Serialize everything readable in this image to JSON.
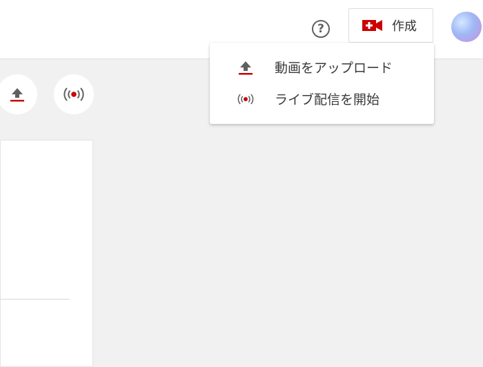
{
  "header": {
    "help_icon": "help-circle-icon",
    "help_glyph": "?",
    "create_button": {
      "label": "作成",
      "icon": "video-camera-plus-icon"
    },
    "avatar_icon": "account-avatar"
  },
  "toolbar": {
    "upload_icon": "upload-icon",
    "live_icon": "live-broadcast-icon"
  },
  "create_menu": {
    "items": [
      {
        "label": "動画をアップロード",
        "icon": "upload-icon"
      },
      {
        "label": "ライブ配信を開始",
        "icon": "live-broadcast-icon"
      }
    ]
  },
  "colors": {
    "accent_red": "#cc0000",
    "icon_gray": "#606060",
    "background": "#f1f1f1",
    "surface": "#ffffff"
  }
}
